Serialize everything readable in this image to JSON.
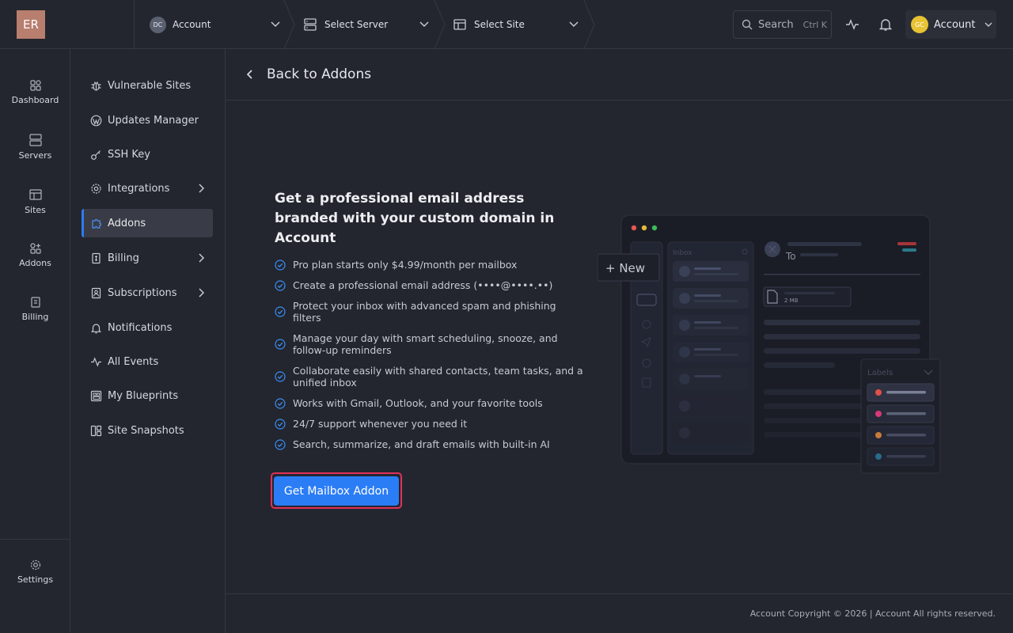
{
  "app": {
    "logo": "ER"
  },
  "topbar": {
    "account_crumb": {
      "avatar": "DC",
      "label": "Account"
    },
    "server_crumb": {
      "label": "Select Server"
    },
    "site_crumb": {
      "label": "Select Site"
    },
    "search": {
      "label": "Search",
      "shortcut": "Ctrl K"
    },
    "account_button": {
      "avatar": "GC",
      "label": "Account"
    }
  },
  "rail": {
    "items": [
      {
        "label": "Dashboard",
        "icon": "dashboard-icon"
      },
      {
        "label": "Servers",
        "icon": "server-icon"
      },
      {
        "label": "Sites",
        "icon": "sites-icon"
      },
      {
        "label": "Addons",
        "icon": "addons-icon"
      },
      {
        "label": "Billing",
        "icon": "billing-icon"
      }
    ],
    "settings": {
      "label": "Settings",
      "icon": "gear-icon"
    }
  },
  "sidebar": {
    "items": [
      {
        "label": "Vulnerable Sites",
        "icon": "bug-icon"
      },
      {
        "label": "Updates Manager",
        "icon": "wordpress-icon"
      },
      {
        "label": "SSH Key",
        "icon": "key-icon"
      },
      {
        "label": "Integrations",
        "icon": "gear-icon",
        "expandable": true
      },
      {
        "label": "Addons",
        "icon": "puzzle-icon",
        "active": true
      },
      {
        "label": "Billing",
        "icon": "receipt-icon",
        "expandable": true
      },
      {
        "label": "Subscriptions",
        "icon": "subscription-icon",
        "expandable": true
      },
      {
        "label": "Notifications",
        "icon": "bell-icon"
      },
      {
        "label": "All Events",
        "icon": "activity-icon"
      },
      {
        "label": "My Blueprints",
        "icon": "blueprint-icon"
      },
      {
        "label": "Site Snapshots",
        "icon": "snapshot-icon"
      }
    ]
  },
  "main": {
    "back_label": "Back to Addons",
    "promo": {
      "title": "Get a professional email address branded with your custom domain in Account",
      "features": [
        "Pro plan starts only $4.99/month per mailbox",
        "Create a professional email address (••••@••••.••)",
        "Protect your inbox with advanced spam and phishing filters",
        "Manage your day with smart scheduling, snooze, and follow-up reminders",
        "Collaborate easily with shared contacts, team tasks, and a unified inbox",
        "Works with Gmail, Outlook, and your favorite tools",
        "24/7 support whenever you need it",
        "Search, summarize, and draft emails with built-in AI"
      ],
      "cta_label": "Get Mailbox Addon"
    },
    "illustration": {
      "new_button": "+ New",
      "inbox_label": "Inbox",
      "to_label": "To",
      "attachment_size": "2 MB",
      "labels_title": "Labels",
      "label_colors": [
        "#e0504a",
        "#d63a78",
        "#c87a3a",
        "#2a6a8a"
      ]
    }
  },
  "footer": {
    "text": "Account Copyright © 2026 | Account All rights reserved."
  },
  "colors": {
    "accent": "#2b7df6",
    "highlight": "#e0305a",
    "background": "#23262e"
  }
}
